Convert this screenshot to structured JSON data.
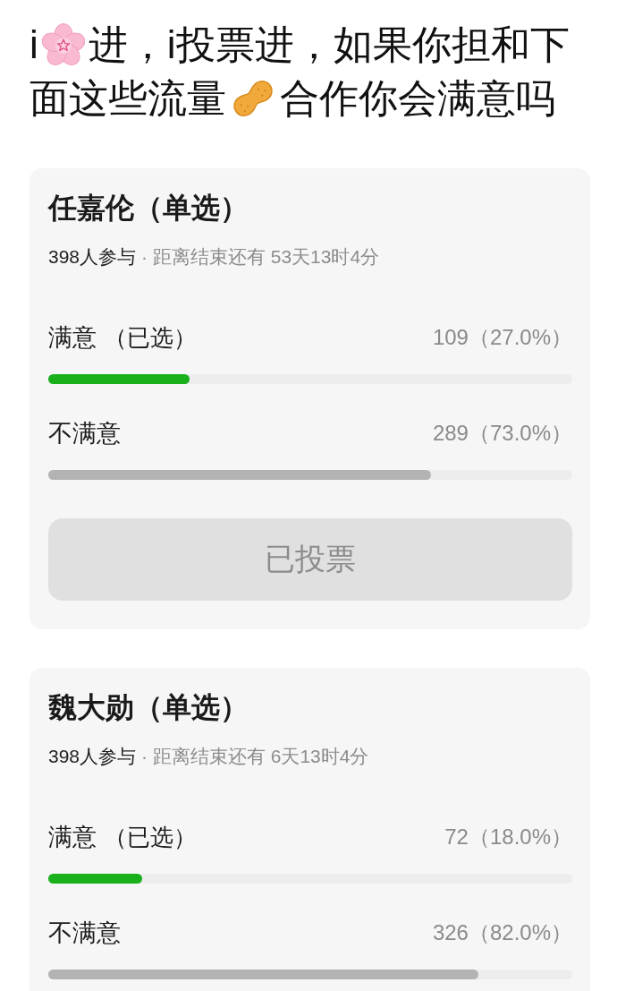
{
  "post": {
    "lines": [
      {
        "segments": [
          {
            "kind": "text",
            "text": "i"
          },
          {
            "kind": "flower"
          },
          {
            "kind": "text",
            "text": "进，i投票进，如果你担和下"
          }
        ]
      },
      {
        "segments": [
          {
            "kind": "text",
            "text": "面这些流量"
          },
          {
            "kind": "peanut"
          },
          {
            "kind": "text",
            "text": "合作你会满意吗"
          }
        ]
      }
    ]
  },
  "polls": [
    {
      "title": "任嘉伦（单选）",
      "participants": "398人参与",
      "deadline": "· 距离结束还有 53天13时4分",
      "options": [
        {
          "label": "满意",
          "note": "（已选）",
          "selected": true,
          "count": "109（27.0%）",
          "level": 0.27
        },
        {
          "label": "不满意",
          "selected": false,
          "count": "289（73.0%）",
          "level": 0.73
        }
      ],
      "button": {
        "label": "已投票",
        "disabled": true
      }
    },
    {
      "title": "魏大勋（单选）",
      "participants": "398人参与",
      "deadline": "· 距离结束还有 6天13时4分",
      "options": [
        {
          "label": "满意",
          "note": "（已选）",
          "selected": true,
          "count": "72（18.0%）",
          "level": 0.18
        },
        {
          "label": "不满意",
          "selected": false,
          "count": "326（82.0%）",
          "level": 0.82
        }
      ]
    }
  ]
}
